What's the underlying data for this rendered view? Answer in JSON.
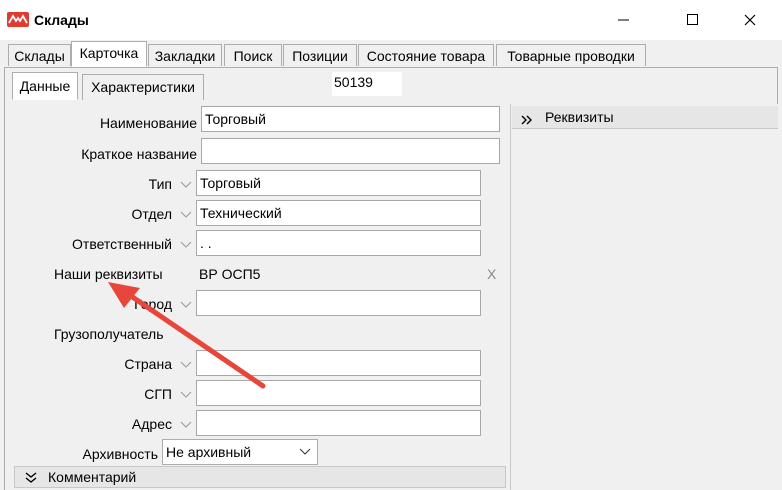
{
  "window": {
    "title": "Склады",
    "logo_icon": "app-logo-icon",
    "controls": [
      "minimize-icon",
      "maximize-icon",
      "close-icon"
    ]
  },
  "tabs": [
    {
      "label": "Склады",
      "active": false
    },
    {
      "label": "Карточка",
      "active": true
    },
    {
      "label": "Закладки",
      "active": false
    },
    {
      "label": "Поиск",
      "active": false
    },
    {
      "label": "Позиции",
      "active": false
    },
    {
      "label": "Состояние товара",
      "active": false
    },
    {
      "label": "Товарные проводки",
      "active": false
    }
  ],
  "subtabs": [
    {
      "label": "Данные",
      "active": true
    },
    {
      "label": "Характеристики",
      "active": false
    }
  ],
  "doc_number": "50139",
  "form": {
    "name": {
      "label": "Наименование",
      "value": "Торговый"
    },
    "short_name": {
      "label": "Краткое название",
      "value": ""
    },
    "type": {
      "label": "Тип",
      "value": "Торговый"
    },
    "department": {
      "label": "Отдел",
      "value": "Технический"
    },
    "responsible": {
      "label": "Ответственный",
      "value": ". ."
    },
    "our_details": {
      "label": "Наши реквизиты",
      "value": "ВР ОСП5",
      "clear": "X"
    },
    "city": {
      "label": "Город",
      "value": ""
    },
    "consignee": {
      "label": "Грузополучатель"
    },
    "country": {
      "label": "Страна",
      "value": ""
    },
    "sgp": {
      "label": "СГП",
      "value": ""
    },
    "address": {
      "label": "Адрес",
      "value": ""
    },
    "archive": {
      "label": "Архивность",
      "value": "Не архивный"
    }
  },
  "rekvizity": {
    "title": "Реквизиты",
    "icon": "double-chevron-right-icon"
  },
  "comment": {
    "title": "Комментарий",
    "icon": "double-chevron-down-icon"
  },
  "colors": {
    "accent_red": "#e03b2f",
    "arrow": "#e8463a"
  }
}
